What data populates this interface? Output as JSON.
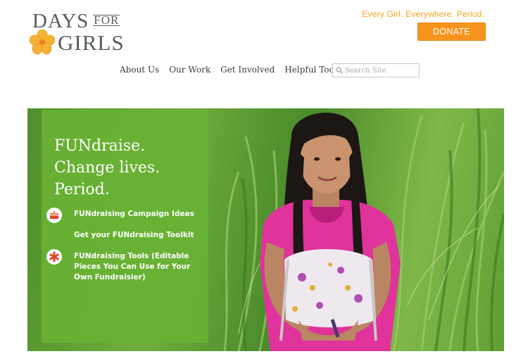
{
  "brand": {
    "logo_line1": "DAYS",
    "logo_for": "FOR",
    "logo_line2": "GIRLS",
    "tagline": "Every Girl. Everywhere. Period."
  },
  "header": {
    "donate_label": "DONATE"
  },
  "nav": {
    "items": [
      {
        "label": "About Us"
      },
      {
        "label": "Our Work"
      },
      {
        "label": "Get Involved"
      },
      {
        "label": "Helpful Tools"
      }
    ]
  },
  "search": {
    "placeholder": "Search Site",
    "icon": "search-icon"
  },
  "hero": {
    "headline": [
      "FUNdraise.",
      "Change lives.",
      "Period."
    ],
    "links": [
      {
        "label_lines": [
          "FUNdraising Campaign Ideas"
        ],
        "icon": "cake-icon"
      },
      {
        "label_lines": [
          "Get your FUNdraising Toolkit"
        ],
        "icon": ""
      },
      {
        "label_lines": [
          "FUNdraising Tools (Editable",
          "Pieces You Can Use for Your",
          "Own Fundraisier)"
        ],
        "icon": "asterisk-icon"
      }
    ]
  },
  "colors": {
    "accent": "#f7941d",
    "panel_green": "#68b234",
    "logo_gray": "#555c5f",
    "icon_red": "#e2452a"
  }
}
